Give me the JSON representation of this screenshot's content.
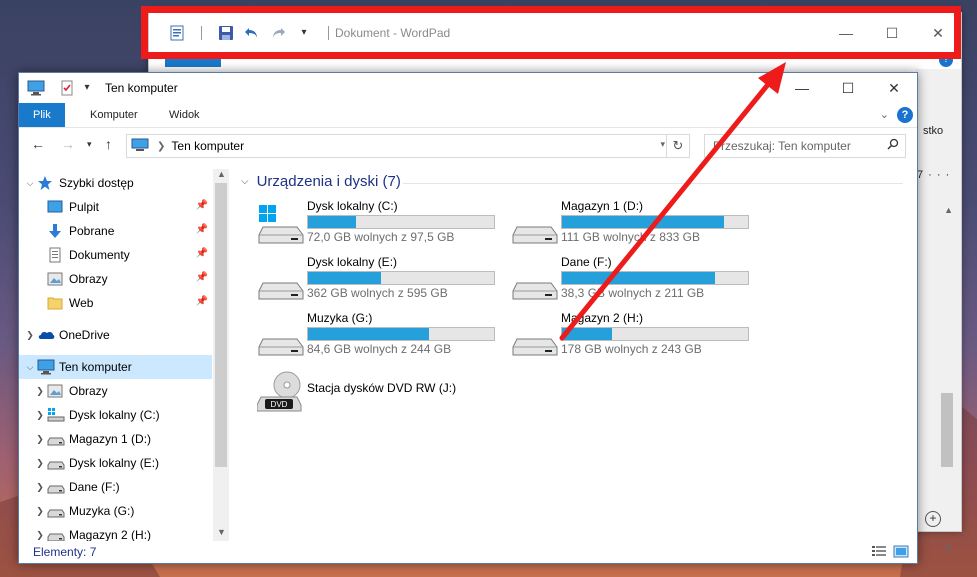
{
  "wordpad": {
    "title": "Dokument - WordPad",
    "side_text_1": "stko",
    "side_text_2": "7 · · ·"
  },
  "explorer": {
    "title": "Ten komputer",
    "ribbon_tabs": [
      "Plik",
      "Komputer",
      "Widok"
    ],
    "address": "Ten komputer",
    "search_placeholder": "Przeszukaj: Ten komputer",
    "sidebar": [
      {
        "label": "Szybki dostęp",
        "icon": "star-icon",
        "level": 0,
        "expanded": true
      },
      {
        "label": "Pulpit",
        "icon": "desktop-icon",
        "level": 1,
        "pinned": true
      },
      {
        "label": "Pobrane",
        "icon": "download-icon",
        "level": 1,
        "pinned": true
      },
      {
        "label": "Dokumenty",
        "icon": "documents-icon",
        "level": 1,
        "pinned": true
      },
      {
        "label": "Obrazy",
        "icon": "pictures-icon",
        "level": 1,
        "pinned": true
      },
      {
        "label": "Web",
        "icon": "folder-icon",
        "level": 1,
        "pinned": true
      },
      {
        "label": "OneDrive",
        "icon": "onedrive-icon",
        "level": 0,
        "expanded": false
      },
      {
        "label": "Ten komputer",
        "icon": "computer-icon",
        "level": 0,
        "expanded": true,
        "selected": true
      },
      {
        "label": "Obrazy",
        "icon": "pictures-icon",
        "level": 1
      },
      {
        "label": "Dysk lokalny (C:)",
        "icon": "system-drive-icon",
        "level": 1
      },
      {
        "label": "Magazyn 1 (D:)",
        "icon": "drive-icon",
        "level": 1
      },
      {
        "label": "Dysk lokalny (E:)",
        "icon": "drive-icon",
        "level": 1
      },
      {
        "label": "Dane (F:)",
        "icon": "drive-icon",
        "level": 1
      },
      {
        "label": "Muzyka (G:)",
        "icon": "drive-icon",
        "level": 1
      },
      {
        "label": "Magazyn 2 (H:)",
        "icon": "drive-icon",
        "level": 1
      }
    ],
    "group_title": "Urządzenia i dyski (7)",
    "drives": [
      {
        "name": "Dysk lokalny (C:)",
        "free": "72,0 GB wolnych z 97,5 GB",
        "used_fraction": 0.26,
        "system": true
      },
      {
        "name": "Magazyn 1 (D:)",
        "free": "111 GB wolnych z 833 GB",
        "used_fraction": 0.87
      },
      {
        "name": "Dysk lokalny (E:)",
        "free": "362 GB wolnych z 595 GB",
        "used_fraction": 0.39
      },
      {
        "name": "Dane (F:)",
        "free": "38,3 GB wolnych z 211 GB",
        "used_fraction": 0.82
      },
      {
        "name": "Muzyka (G:)",
        "free": "84,6 GB wolnych z 244 GB",
        "used_fraction": 0.65
      },
      {
        "name": "Magazyn 2 (H:)",
        "free": "178 GB wolnych z 243 GB",
        "used_fraction": 0.27
      }
    ],
    "dvd": {
      "name": "Stacja dysków DVD RW (J:)",
      "badge": "DVD"
    },
    "status": "Elementy: 7"
  },
  "colors": {
    "accent": "#1979ca",
    "bar_fill": "#26a0da",
    "annotation": "#ee1b1b",
    "selection": "#cce8ff",
    "group_title": "#1e3287"
  }
}
